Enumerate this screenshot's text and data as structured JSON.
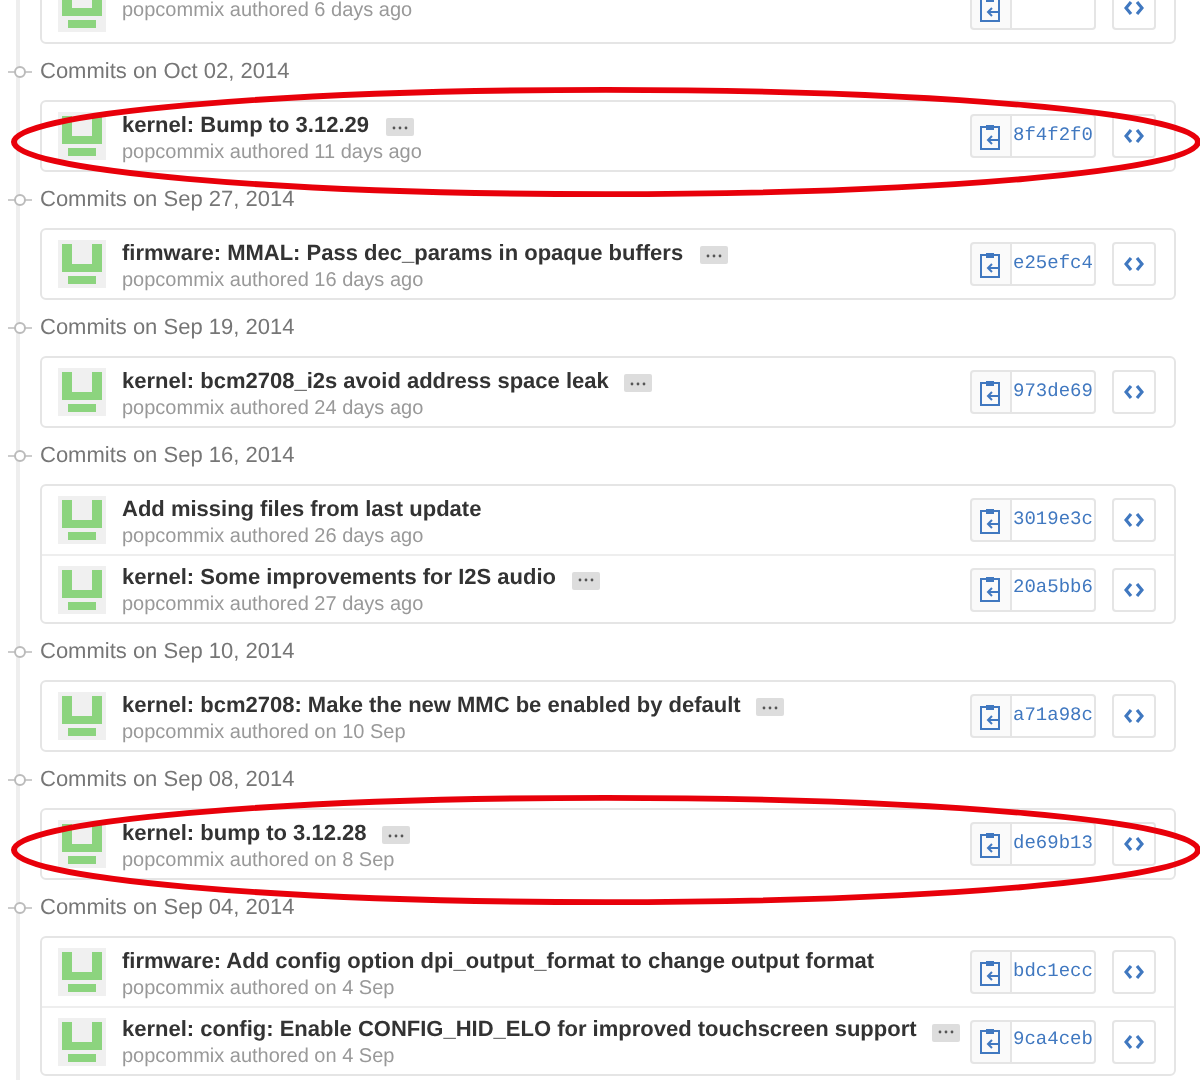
{
  "groups": [
    {
      "commits": [
        {
          "meta": "popcommix authored 6 days ago",
          "highlighted": false,
          "expandable": false
        }
      ]
    },
    {
      "heading": "Commits on Oct 02, 2014",
      "commits": [
        {
          "title": "kernel: Bump to 3.12.29",
          "meta": "popcommix authored 11 days ago",
          "sha": "8f4f2f0",
          "expandable": true,
          "highlighted": true
        }
      ]
    },
    {
      "heading": "Commits on Sep 27, 2014",
      "commits": [
        {
          "title": "firmware: MMAL: Pass dec_params in opaque buffers",
          "meta": "popcommix authored 16 days ago",
          "sha": "e25efc4",
          "expandable": true,
          "highlighted": false
        }
      ]
    },
    {
      "heading": "Commits on Sep 19, 2014",
      "commits": [
        {
          "title": "kernel: bcm2708_i2s avoid address space leak",
          "meta": "popcommix authored 24 days ago",
          "sha": "973de69",
          "expandable": true,
          "highlighted": false
        }
      ]
    },
    {
      "heading": "Commits on Sep 16, 2014",
      "commits": [
        {
          "title": "Add missing files from last update",
          "meta": "popcommix authored 26 days ago",
          "sha": "3019e3c",
          "expandable": false,
          "highlighted": false
        },
        {
          "title": "kernel: Some improvements for I2S audio",
          "meta": "popcommix authored 27 days ago",
          "sha": "20a5bb6",
          "expandable": true,
          "highlighted": false
        }
      ]
    },
    {
      "heading": "Commits on Sep 10, 2014",
      "commits": [
        {
          "title": "kernel: bcm2708: Make the new MMC be enabled by default",
          "meta": "popcommix authored on 10 Sep",
          "sha": "a71a98c",
          "expandable": true,
          "highlighted": false
        }
      ]
    },
    {
      "heading": "Commits on Sep 08, 2014",
      "commits": [
        {
          "title": "kernel: bump to 3.12.28",
          "meta": "popcommix authored on 8 Sep",
          "sha": "de69b13",
          "expandable": true,
          "highlighted": true
        }
      ]
    },
    {
      "heading": "Commits on Sep 04, 2014",
      "commits": [
        {
          "title": "firmware: Add config option dpi_output_format to change output format",
          "meta": "popcommix authored on 4 Sep",
          "sha": "bdc1ecc",
          "expandable": false,
          "highlighted": false
        },
        {
          "title": "kernel: config: Enable CONFIG_HID_ELO for improved touchscreen support",
          "meta": "popcommix authored on 4 Sep",
          "sha": "9ca4ceb",
          "expandable": true,
          "highlighted": false
        }
      ]
    }
  ]
}
